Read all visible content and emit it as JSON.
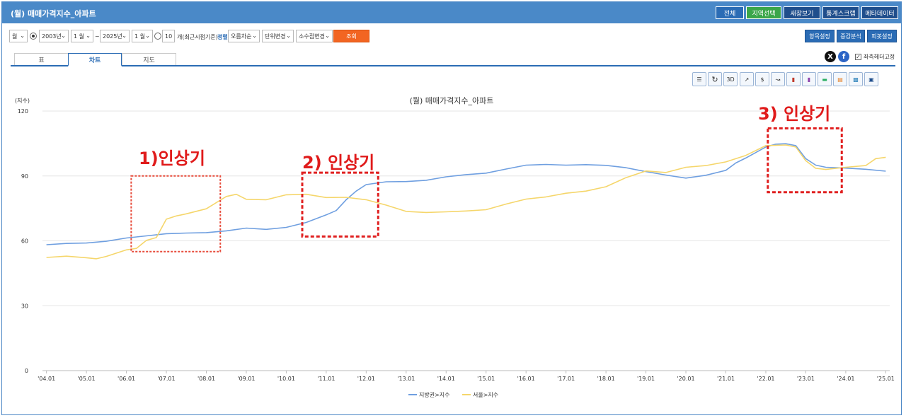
{
  "header": {
    "title": "(월) 매매가격지수_아파트",
    "buttons": [
      {
        "label": "전체",
        "color": "#2b6cb5"
      },
      {
        "label": "지역선택",
        "color": "#3aa649"
      },
      {
        "label": "새창보기",
        "color": "#1f4e8c"
      },
      {
        "label": "통계스크랩",
        "color": "#1f4e8c"
      },
      {
        "label": "메타데이터",
        "color": "#1f4e8c"
      }
    ]
  },
  "toolbar": {
    "period_type": "월",
    "start_year": "2003년",
    "start_month": "1 월",
    "tilde": "~",
    "end_year": "2025년",
    "end_month": "1 월",
    "recent_count": "10",
    "recent_label": "개(최근시점기준)",
    "sort_label": "정렬",
    "sort_value": "오름차순",
    "unit_value": "단위변경",
    "decimal_value": "소수점변경",
    "search_label": "조회",
    "right_buttons": [
      "항목설정",
      "증감분석",
      "피봇설정"
    ]
  },
  "tabs": [
    {
      "label": "표",
      "active": false
    },
    {
      "label": "차트",
      "active": true
    },
    {
      "label": "지도",
      "active": false
    }
  ],
  "share": {
    "x_icon": "X",
    "fb_icon": "f",
    "fix_header_label": "좌측헤더고정",
    "fix_header_checked": true
  },
  "chart_toolbar_icons": [
    "list-icon",
    "refresh-icon",
    "3d-icon",
    "line-chart-icon",
    "dollar-line-icon",
    "multi-line-icon",
    "bar-chart-icon",
    "dollar-bar-icon",
    "horizontal-bar-icon",
    "stacked-bar-icon",
    "dollar-stacked-icon",
    "save-icon"
  ],
  "chart_toolbar_3d_label": "3D",
  "annotations": [
    {
      "label": "1)인상기"
    },
    {
      "label": "2) 인상기"
    },
    {
      "label": "3) 인상기"
    }
  ],
  "chart_data": {
    "type": "line",
    "title": "(월) 매매가격지수_아파트",
    "ylabel": "(지수)",
    "ylim": [
      0,
      120
    ],
    "yticks": [
      0,
      30,
      60,
      90,
      120
    ],
    "xlim": [
      2003.9,
      2025.1
    ],
    "xticks": [
      {
        "x": 2004,
        "label": "'04.01"
      },
      {
        "x": 2005,
        "label": "'05.01"
      },
      {
        "x": 2006,
        "label": "'06.01"
      },
      {
        "x": 2007,
        "label": "'07.01"
      },
      {
        "x": 2008,
        "label": "'08.01"
      },
      {
        "x": 2009,
        "label": "'09.01"
      },
      {
        "x": 2010,
        "label": "'10.01"
      },
      {
        "x": 2011,
        "label": "'11.01"
      },
      {
        "x": 2012,
        "label": "'12.01"
      },
      {
        "x": 2013,
        "label": "'13.01"
      },
      {
        "x": 2014,
        "label": "'14.01"
      },
      {
        "x": 2015,
        "label": "'15.01"
      },
      {
        "x": 2016,
        "label": "'16.01"
      },
      {
        "x": 2017,
        "label": "'17.01"
      },
      {
        "x": 2018,
        "label": "'18.01"
      },
      {
        "x": 2019,
        "label": "'19.01"
      },
      {
        "x": 2020,
        "label": "'20.01"
      },
      {
        "x": 2021,
        "label": "'21.01"
      },
      {
        "x": 2022,
        "label": "'22.01"
      },
      {
        "x": 2023,
        "label": "'23.01"
      },
      {
        "x": 2024,
        "label": "'24.01"
      },
      {
        "x": 2025,
        "label": "'25.01"
      }
    ],
    "grid": true,
    "legend_position": "bottom",
    "series": [
      {
        "name": "지방권>지수",
        "color": "#6f9fe0",
        "points": [
          [
            2004.0,
            58.2
          ],
          [
            2004.5,
            58.8
          ],
          [
            2005.0,
            59.0
          ],
          [
            2005.5,
            59.8
          ],
          [
            2006.0,
            61.3
          ],
          [
            2006.5,
            62.3
          ],
          [
            2007.0,
            63.3
          ],
          [
            2007.5,
            63.6
          ],
          [
            2008.0,
            63.8
          ],
          [
            2008.5,
            64.6
          ],
          [
            2009.0,
            65.9
          ],
          [
            2009.5,
            65.3
          ],
          [
            2010.0,
            66.2
          ],
          [
            2010.5,
            68.5
          ],
          [
            2011.0,
            72.0
          ],
          [
            2011.25,
            74.0
          ],
          [
            2011.5,
            79.0
          ],
          [
            2011.75,
            83.0
          ],
          [
            2012.0,
            86.0
          ],
          [
            2012.5,
            87.3
          ],
          [
            2013.0,
            87.4
          ],
          [
            2013.5,
            88.0
          ],
          [
            2014.0,
            89.6
          ],
          [
            2014.5,
            90.6
          ],
          [
            2015.0,
            91.3
          ],
          [
            2015.5,
            93.2
          ],
          [
            2016.0,
            95.0
          ],
          [
            2016.5,
            95.3
          ],
          [
            2017.0,
            95.0
          ],
          [
            2017.5,
            95.2
          ],
          [
            2018.0,
            94.9
          ],
          [
            2018.5,
            93.8
          ],
          [
            2019.0,
            92.0
          ],
          [
            2019.5,
            90.4
          ],
          [
            2020.0,
            89.0
          ],
          [
            2020.5,
            90.3
          ],
          [
            2021.0,
            92.6
          ],
          [
            2021.25,
            96.0
          ],
          [
            2021.5,
            98.3
          ],
          [
            2022.0,
            103.4
          ],
          [
            2022.25,
            104.7
          ],
          [
            2022.5,
            104.9
          ],
          [
            2022.75,
            104.0
          ],
          [
            2023.0,
            98.0
          ],
          [
            2023.25,
            95.0
          ],
          [
            2023.5,
            94.0
          ],
          [
            2024.0,
            93.6
          ],
          [
            2024.5,
            93.1
          ],
          [
            2025.0,
            92.2
          ]
        ]
      },
      {
        "name": "서울>지수",
        "color": "#f5d66b",
        "points": [
          [
            2004.0,
            52.3
          ],
          [
            2004.5,
            52.9
          ],
          [
            2005.0,
            52.2
          ],
          [
            2005.25,
            51.7
          ],
          [
            2005.5,
            52.8
          ],
          [
            2006.0,
            55.8
          ],
          [
            2006.25,
            56.5
          ],
          [
            2006.5,
            60.2
          ],
          [
            2006.75,
            61.5
          ],
          [
            2007.0,
            70.0
          ],
          [
            2007.25,
            71.5
          ],
          [
            2007.5,
            72.5
          ],
          [
            2008.0,
            74.8
          ],
          [
            2008.5,
            80.5
          ],
          [
            2008.75,
            81.5
          ],
          [
            2009.0,
            79.2
          ],
          [
            2009.5,
            79.0
          ],
          [
            2010.0,
            81.3
          ],
          [
            2010.5,
            81.5
          ],
          [
            2011.0,
            80.0
          ],
          [
            2011.5,
            80.1
          ],
          [
            2012.0,
            79.0
          ],
          [
            2012.5,
            76.5
          ],
          [
            2013.0,
            73.6
          ],
          [
            2013.5,
            73.1
          ],
          [
            2014.0,
            73.4
          ],
          [
            2014.5,
            73.8
          ],
          [
            2015.0,
            74.4
          ],
          [
            2015.5,
            77.0
          ],
          [
            2016.0,
            79.3
          ],
          [
            2016.5,
            80.3
          ],
          [
            2017.0,
            82.0
          ],
          [
            2017.5,
            83.0
          ],
          [
            2018.0,
            85.0
          ],
          [
            2018.5,
            89.2
          ],
          [
            2019.0,
            92.3
          ],
          [
            2019.5,
            91.6
          ],
          [
            2020.0,
            94.0
          ],
          [
            2020.5,
            94.8
          ],
          [
            2021.0,
            96.5
          ],
          [
            2021.5,
            99.5
          ],
          [
            2022.0,
            104.0
          ],
          [
            2022.5,
            104.3
          ],
          [
            2022.75,
            103.4
          ],
          [
            2023.0,
            97.0
          ],
          [
            2023.25,
            93.5
          ],
          [
            2023.5,
            93.0
          ],
          [
            2024.0,
            94.0
          ],
          [
            2024.5,
            94.8
          ],
          [
            2024.75,
            98.0
          ],
          [
            2025.0,
            98.6
          ]
        ]
      }
    ]
  }
}
